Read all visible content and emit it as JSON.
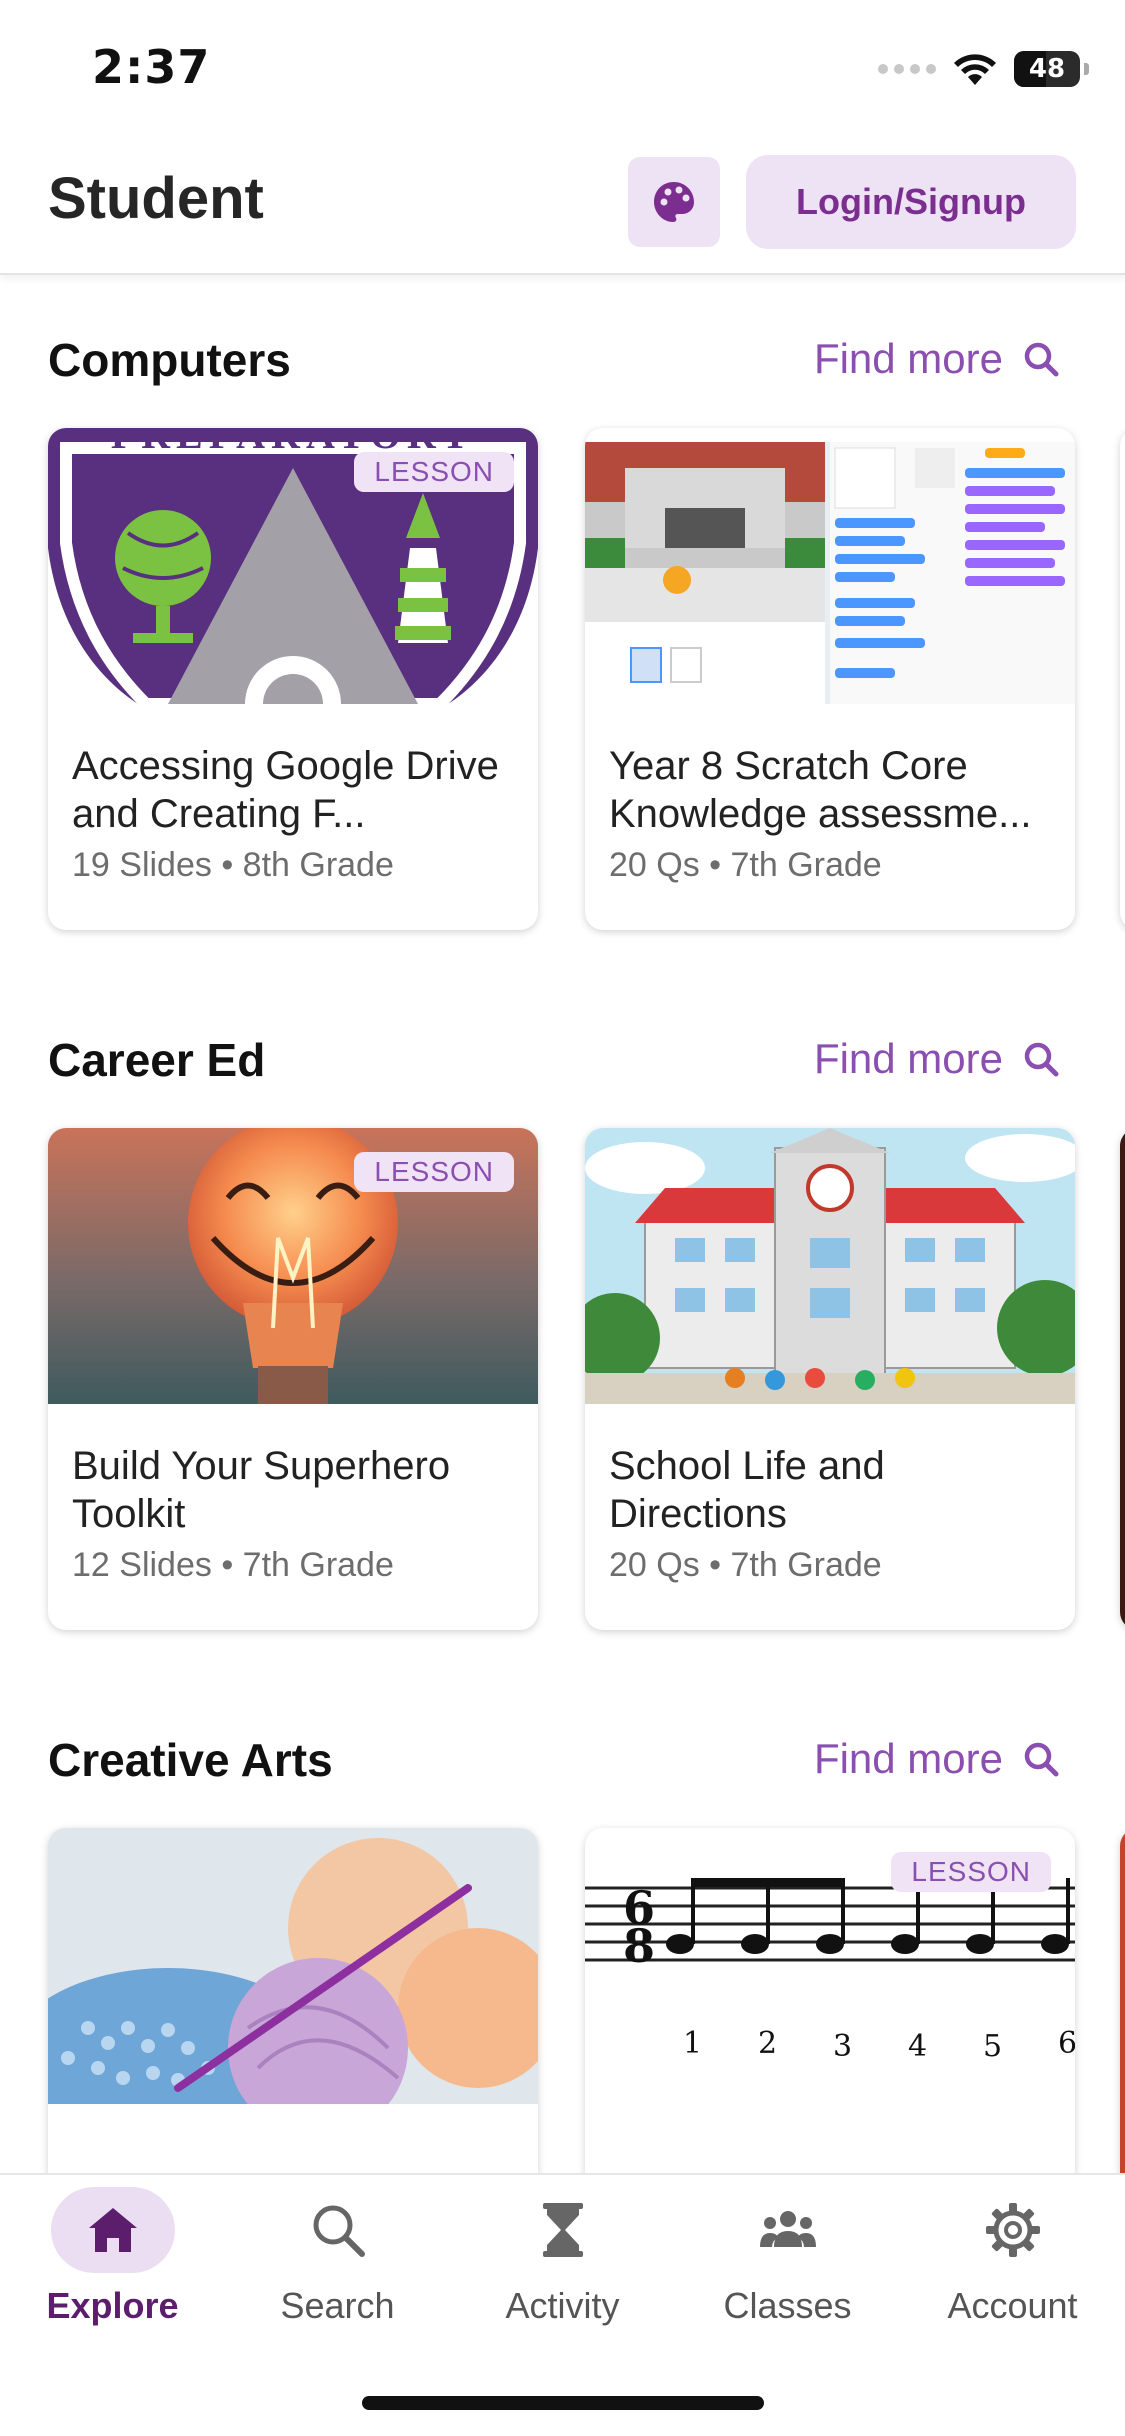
{
  "status": {
    "time": "2:37",
    "battery": "48",
    "battery_level": 0.48
  },
  "header": {
    "title": "Student",
    "login_label": "Login/Signup",
    "theme_icon": "palette-icon"
  },
  "sections": [
    {
      "title": "Computers",
      "find_more": "Find more",
      "cards": [
        {
          "badge": "LESSON",
          "title": "Accessing Google Drive and Creating F...",
          "meta": "19 Slides • 8th Grade",
          "image": "preparatory-school-crest",
          "image_text": "PREPARATORY"
        },
        {
          "badge": "",
          "title": "Year 8 Scratch Core Knowledge assessme...",
          "meta": "20 Qs • 7th Grade",
          "image": "scratch-editor-screenshot"
        }
      ]
    },
    {
      "title": "Career Ed",
      "find_more": "Find more",
      "cards": [
        {
          "badge": "LESSON",
          "title": "Build Your Superhero Toolkit",
          "meta": "12 Slides • 7th Grade",
          "image": "smiling-lightbulb"
        },
        {
          "badge": "",
          "title": "School Life and Directions",
          "meta": "20 Qs • 7th Grade",
          "image": "school-building-cartoon"
        }
      ]
    },
    {
      "title": "Creative Arts",
      "find_more": "Find more",
      "cards": [
        {
          "badge": "",
          "title": "",
          "meta": "",
          "image": "yarn-and-crochet"
        },
        {
          "badge": "LESSON",
          "title": "",
          "meta": "",
          "image": "sheet-music-6-8",
          "image_text": [
            "1",
            "2",
            "3",
            "4",
            "5",
            "6"
          ]
        }
      ]
    }
  ],
  "nav": [
    {
      "label": "Explore",
      "icon": "home-icon",
      "active": true
    },
    {
      "label": "Search",
      "icon": "search-icon",
      "active": false
    },
    {
      "label": "Activity",
      "icon": "hourglass-icon",
      "active": false
    },
    {
      "label": "Classes",
      "icon": "people-icon",
      "active": false
    },
    {
      "label": "Account",
      "icon": "gear-icon",
      "active": false
    }
  ],
  "colors": {
    "accent": "#8a4fb0",
    "accent_dark": "#5b1d6c",
    "accent_light": "#ede3f4"
  }
}
